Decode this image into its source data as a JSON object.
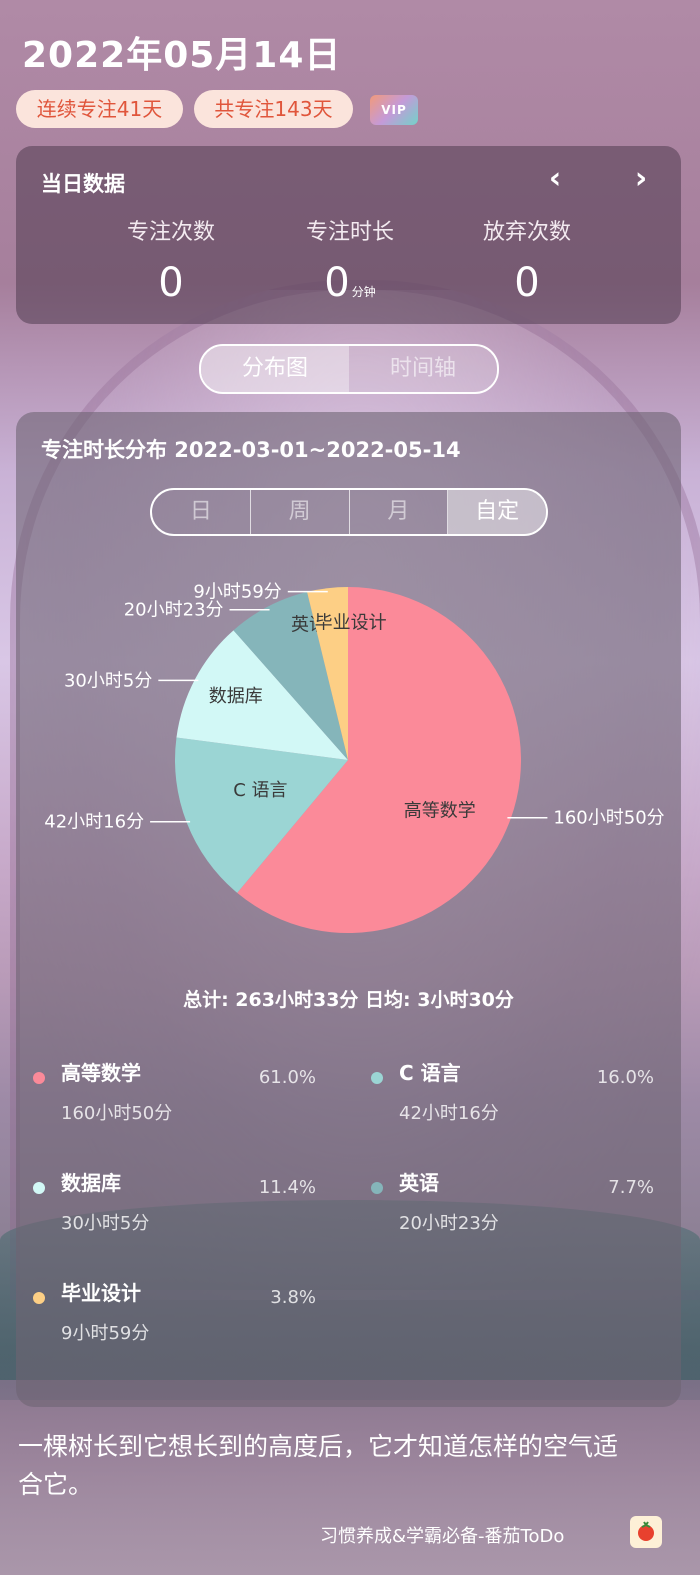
{
  "date_title": "2022年05月14日",
  "badges": {
    "streak": "连续专注41天",
    "total": "共专注143天",
    "vip": "VIP"
  },
  "daily": {
    "title": "当日数据",
    "stats": [
      {
        "label": "专注次数",
        "value": "0",
        "unit": ""
      },
      {
        "label": "专注时长",
        "value": "0",
        "unit": "分钟"
      },
      {
        "label": "放弃次数",
        "value": "0",
        "unit": ""
      }
    ]
  },
  "view_tabs": [
    "分布图",
    "时间轴"
  ],
  "distribution": {
    "title": "专注时长分布 2022-03-01~2022-05-14",
    "period_tabs": [
      "日",
      "周",
      "月",
      "自定"
    ],
    "summary": "总计: 263小时33分  日均: 3小时30分",
    "legend": [
      {
        "name": "高等数学",
        "percent": "61.0%",
        "duration": "160小时50分"
      },
      {
        "name": "C 语言",
        "percent": "16.0%",
        "duration": "42小时16分"
      },
      {
        "name": "数据库",
        "percent": "11.4%",
        "duration": "30小时5分"
      },
      {
        "name": "英语",
        "percent": "7.7%",
        "duration": "20小时23分"
      },
      {
        "name": "毕业设计",
        "percent": "3.8%",
        "duration": "9小时59分"
      }
    ]
  },
  "chart_data": {
    "type": "pie",
    "labels": [
      "高等数学",
      "C 语言",
      "数据库",
      "英语",
      "毕业设计"
    ],
    "values": [
      61.0,
      16.0,
      11.4,
      7.7,
      3.8
    ],
    "value_labels": [
      "160小时50分",
      "42小时16分",
      "30小时5分",
      "20小时23分",
      "9小时59分"
    ],
    "colors": [
      "#fb8a99",
      "#9bd5d4",
      "#d2f8f6",
      "#85b5ba",
      "#fdcf85"
    ]
  },
  "quote": "一棵树长到它想长到的高度后，它才知道怎样的空气适合它。",
  "footer": "习惯养成&学霸必备-番茄ToDo"
}
